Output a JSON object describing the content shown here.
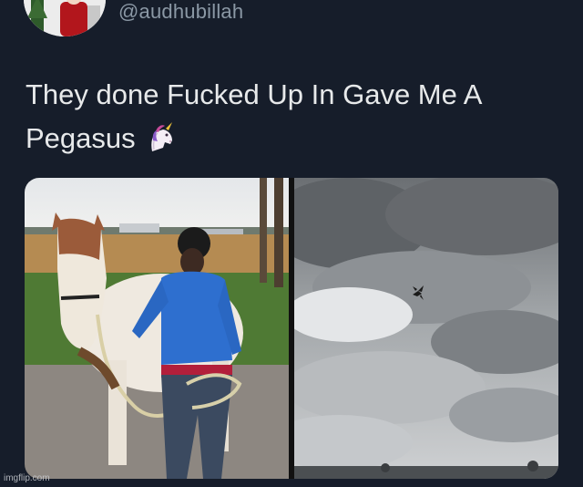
{
  "tweet": {
    "handle": "@audhubillah",
    "text": "They done Fucked Up In Gave Me A Pegasus",
    "emoji": "unicorn-emoji"
  },
  "media": {
    "left_image": "man in blue hoodie holding a white and brown horse on a rope",
    "right_image": "cloudy grey sky with a small flying horse silhouette"
  },
  "watermark": "imgflip.com",
  "colors": {
    "background": "#161d2a",
    "text": "#e7e9ea",
    "handle": "#8b98a5"
  }
}
